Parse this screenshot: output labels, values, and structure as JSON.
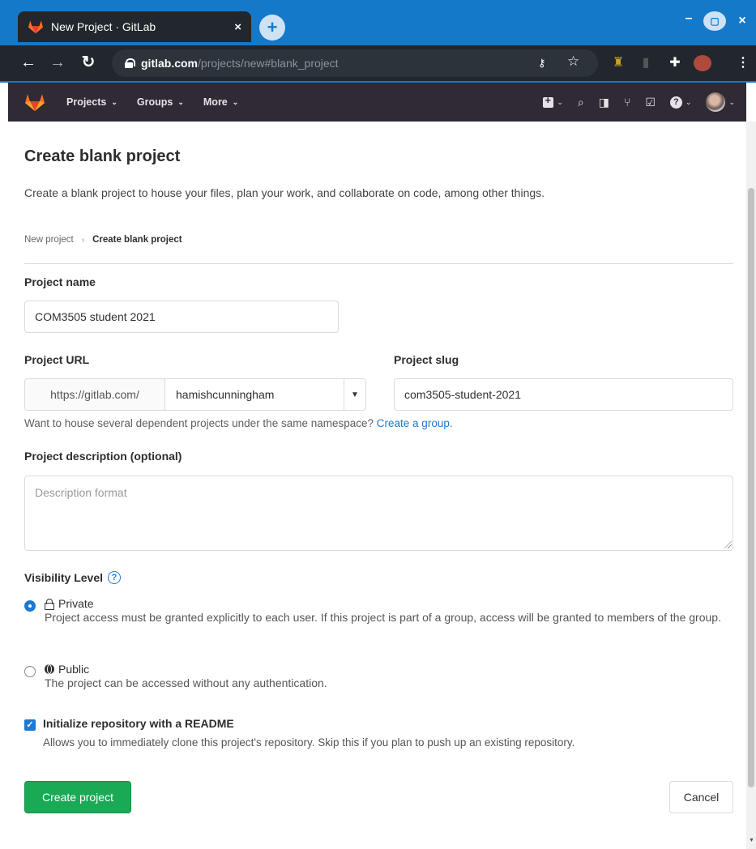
{
  "browser": {
    "tab_title": "New Project · GitLab",
    "tab_close": "×",
    "new_tab": "+",
    "url_host": "gitlab.com",
    "url_path": "/projects/new#blank_project",
    "window_min": "–",
    "window_max": "▢",
    "window_close": "×",
    "icons": [
      "back-icon",
      "forward-icon",
      "reload-icon",
      "lock-icon",
      "key-icon",
      "star-icon",
      "extension-icon",
      "puzzle-icon",
      "profile-icon",
      "menu-icon"
    ]
  },
  "gitlab_nav": {
    "menus": [
      {
        "label": "Projects",
        "chevron": "⌄"
      },
      {
        "label": "Groups",
        "chevron": "⌄"
      },
      {
        "label": "More",
        "chevron": "⌄"
      }
    ],
    "icons": [
      "new-item-icon",
      "search-icon",
      "issues-icon",
      "merge-requests-icon",
      "todos-icon",
      "help-icon",
      "user-avatar-icon"
    ]
  },
  "page": {
    "title": "Create blank project",
    "subtitle": "Create a blank project to house your files, plan your work, and collaborate on code, among other things.",
    "breadcrumb": {
      "parent": "New project",
      "separator": "›",
      "current": "Create blank project"
    }
  },
  "form": {
    "project_name_label": "Project name",
    "project_name_value": "COM3505 student 2021",
    "project_url_label": "Project URL",
    "project_url_prefix": "https://gitlab.com/",
    "project_url_namespace": "hamishcunningham",
    "project_slug_label": "Project slug",
    "project_slug_value": "com3505-student-2021",
    "namespace_help": "Want to house several dependent projects under the same namespace? ",
    "namespace_help_link": "Create a group.",
    "description_label": "Project description (optional)",
    "description_placeholder": "Description format",
    "visibility_label": "Visibility Level",
    "visibility_options": [
      {
        "title": "Private",
        "selected": true,
        "description": "Project access must be granted explicitly to each user. If this project is part of a group, access will be granted to members of the group."
      },
      {
        "title": "Public",
        "selected": false,
        "description": "The project can be accessed without any authentication."
      }
    ],
    "readme_checked": true,
    "readme_label": "Initialize repository with a README",
    "readme_description": "Allows you to immediately clone this project's repository. Skip this if you plan to push up an existing repository.",
    "create_button": "Create project",
    "cancel_button": "Cancel"
  },
  "colors": {
    "browser_frame": "#1479c9",
    "gitlab_nav": "#2f2a34",
    "primary_button": "#1aaa55",
    "link": "#1f78d1"
  }
}
